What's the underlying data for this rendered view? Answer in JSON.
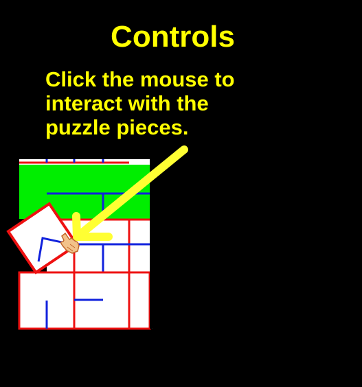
{
  "screen": {
    "title": "Controls",
    "instructions": [
      "Click the mouse to",
      "interact with the",
      "puzzle pieces."
    ]
  },
  "colors": {
    "background": "#000000",
    "text": "#ffff00",
    "arrow": "#ffff33",
    "piece_fill": "#ffffff",
    "piece_border": "#ee1111",
    "maze_line": "#1122dd",
    "green_piece": "#00ee00"
  },
  "icons": {
    "pointer": "hand-cursor-icon",
    "arrow": "arrow-icon"
  }
}
